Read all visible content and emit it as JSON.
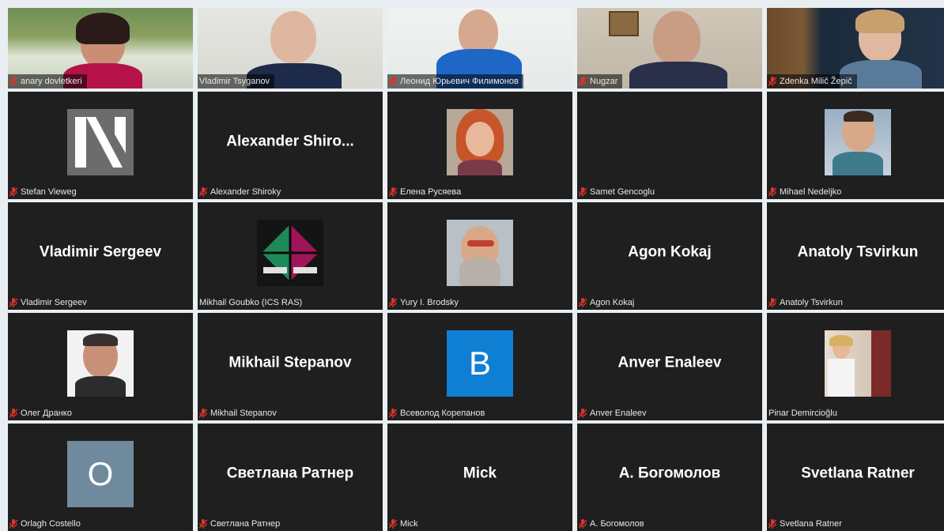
{
  "colors": {
    "tile_bg": "#1f1f1f",
    "muted_mic": "#d9342b",
    "letter_avatar_blue": "#0f7fd4",
    "letter_avatar_gray": "#6f8a9c"
  },
  "participants": [
    {
      "name": "anary dovletkeri",
      "muted": true,
      "kind": "video"
    },
    {
      "name": "Vladimir Tsyganov",
      "muted": false,
      "kind": "video"
    },
    {
      "name": "Леонид Юрьевич Филимонов",
      "muted": true,
      "kind": "video"
    },
    {
      "name": "Nugzar",
      "muted": true,
      "kind": "video"
    },
    {
      "name": "Zdenka Milič Žepič",
      "muted": true,
      "kind": "video"
    },
    {
      "name": "Stefan Vieweg",
      "muted": true,
      "kind": "logo-n"
    },
    {
      "name": "Alexander Shiroky",
      "display": "Alexander Shiro...",
      "muted": true,
      "kind": "text"
    },
    {
      "name": "Елена Русяева",
      "muted": true,
      "kind": "photo"
    },
    {
      "name": "Samet Gencoglu",
      "muted": true,
      "kind": "blank"
    },
    {
      "name": "Mihael Nedeljko",
      "muted": true,
      "kind": "photo"
    },
    {
      "name": "Vladimir Sergeev",
      "display": "Vladimir Sergeev",
      "muted": true,
      "kind": "text"
    },
    {
      "name": "Mikhail Goubko (ICS RAS)",
      "muted": false,
      "kind": "logo-ics"
    },
    {
      "name": "Yury I. Brodsky",
      "muted": true,
      "kind": "photo"
    },
    {
      "name": "Agon Kokaj",
      "display": "Agon Kokaj",
      "muted": true,
      "kind": "text"
    },
    {
      "name": "Anatoly Tsvirkun",
      "display": "Anatoly Tsvirkun",
      "muted": true,
      "kind": "text"
    },
    {
      "name": "Олег Дранко",
      "muted": true,
      "kind": "photo"
    },
    {
      "name": "Mikhail Stepanov",
      "display": "Mikhail Stepanov",
      "muted": true,
      "kind": "text"
    },
    {
      "name": "Всеволод Корепанов",
      "letter": "B",
      "muted": true,
      "kind": "letter-blue"
    },
    {
      "name": "Anver Enaleev",
      "display": "Anver Enaleev",
      "muted": true,
      "kind": "text"
    },
    {
      "name": "Pinar Demircioğlu",
      "muted": false,
      "kind": "photo"
    },
    {
      "name": "Orlagh Costello",
      "letter": "O",
      "muted": true,
      "kind": "letter-gray"
    },
    {
      "name": "Светлана Ратнер",
      "display": "Светлана Ратнер",
      "muted": true,
      "kind": "text"
    },
    {
      "name": "Mick",
      "display": "Mick",
      "muted": true,
      "kind": "text"
    },
    {
      "name": "А. Богомолов",
      "display": "А. Богомолов",
      "muted": true,
      "kind": "text"
    },
    {
      "name": "Svetlana Ratner",
      "display": "Svetlana Ratner",
      "muted": true,
      "kind": "text"
    }
  ]
}
